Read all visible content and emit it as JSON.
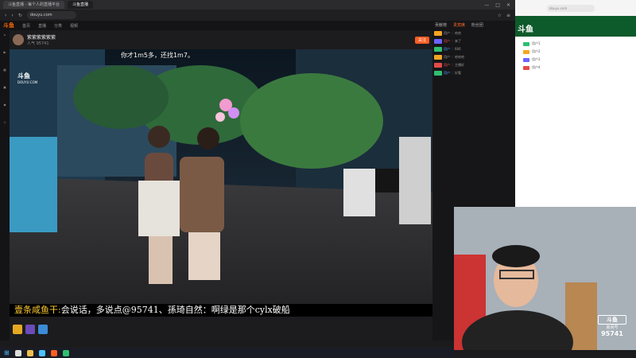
{
  "browser": {
    "tabs": [
      {
        "label": "斗鱼直播 - 每个人的直播平台"
      },
      {
        "label": "斗鱼直播"
      }
    ],
    "address": "douyu.com",
    "window_controls": [
      "—",
      "□",
      "✕"
    ]
  },
  "site_nav": {
    "logo": "斗鱼",
    "items": [
      "首页",
      "直播",
      "分类",
      "视频"
    ]
  },
  "stream": {
    "title": "紫紫紫紫紫紫",
    "subtitle": "人气 95741",
    "follow_label": "关注"
  },
  "video": {
    "top_caption": "你才1m5多，还找1m7。",
    "watermark": "斗鱼",
    "watermark_sub": "DOUYU.COM"
  },
  "subtitle_bar": {
    "highlight": "壹条咸鱼干:",
    "text": "会说话，多说点@95741、孫琦自然：啊绿是那个cylx破船"
  },
  "chat": {
    "tabs": [
      "贡献榜",
      "贵宾席",
      "粉丝团"
    ],
    "messages": [
      {
        "name": "用户",
        "text": "：哈哈"
      },
      {
        "name": "用户",
        "text": "：来了"
      },
      {
        "name": "用户",
        "text": "：666"
      },
      {
        "name": "用户",
        "text": "：哈哈哈"
      },
      {
        "name": "用户",
        "text": "：主播好"
      },
      {
        "name": "用户",
        "text": "：好看"
      }
    ]
  },
  "right_window": {
    "label": "斗鱼",
    "rows": [
      "用户1",
      "用户2",
      "用户3",
      "用户4"
    ]
  },
  "cam_overlay": {
    "logo_top": "斗鱼",
    "logo_mid": "房间号",
    "room_number": "95741"
  },
  "colors": {
    "accent": "#ff5d23",
    "subtitle_highlight": "#ffcc33"
  }
}
